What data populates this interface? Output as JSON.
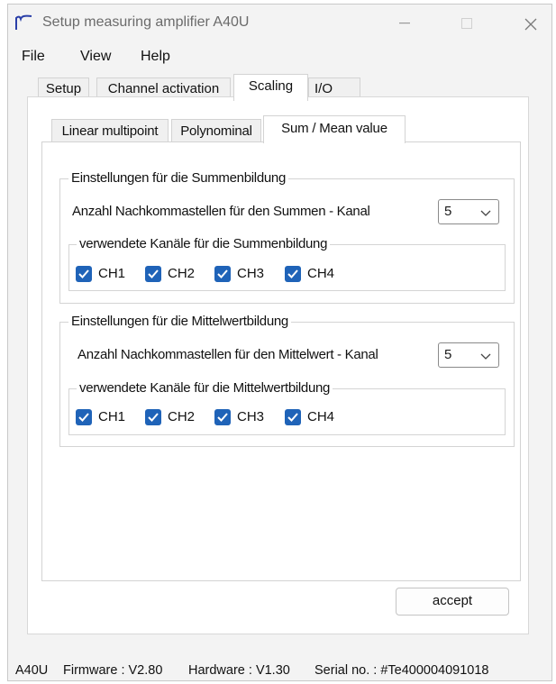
{
  "window": {
    "title": "Setup measuring amplifier A40U"
  },
  "menu": [
    "File",
    "View",
    "Help"
  ],
  "tabs": [
    {
      "label": "Setup"
    },
    {
      "label": "Channel activation"
    },
    {
      "label": "Scaling",
      "active": true
    },
    {
      "label": "I/O"
    }
  ],
  "subtabs": [
    {
      "label": "Linear multipoint"
    },
    {
      "label": "Polynominal"
    },
    {
      "label": "Sum / Mean value",
      "active": true
    }
  ],
  "sum_group": {
    "legend": "Einstellungen für die Summenbildung",
    "decimals_label": "Anzahl Nachkommastellen für den Summen - Kanal",
    "decimals_value": "5",
    "channels_legend": "verwendete Kanäle für die Summenbildung",
    "channels": [
      {
        "label": "CH1",
        "checked": true
      },
      {
        "label": "CH2",
        "checked": true
      },
      {
        "label": "CH3",
        "checked": true
      },
      {
        "label": "CH4",
        "checked": true
      }
    ]
  },
  "mean_group": {
    "legend": "Einstellungen für die Mittelwertbildung",
    "decimals_label": "Anzahl Nachkommastellen für den Mittelwert - Kanal",
    "decimals_value": "5",
    "channels_legend": "verwendete Kanäle für die Mittelwertbildung",
    "channels": [
      {
        "label": "CH1",
        "checked": true
      },
      {
        "label": "CH2",
        "checked": true
      },
      {
        "label": "CH3",
        "checked": true
      },
      {
        "label": "CH4",
        "checked": true
      }
    ]
  },
  "buttons": {
    "accept": "accept"
  },
  "status": {
    "device": "A40U",
    "firmware": "Firmware : V2.80",
    "hardware": "Hardware : V1.30",
    "serial": "Serial no. : #Te400004091018"
  },
  "colors": {
    "checkbox": "#1f63b8",
    "window_bg": "#f3f3f3"
  },
  "icons": {
    "app": "waveform-icon",
    "minimize": "minimize-icon",
    "maximize": "maximize-icon",
    "close": "close-icon"
  }
}
